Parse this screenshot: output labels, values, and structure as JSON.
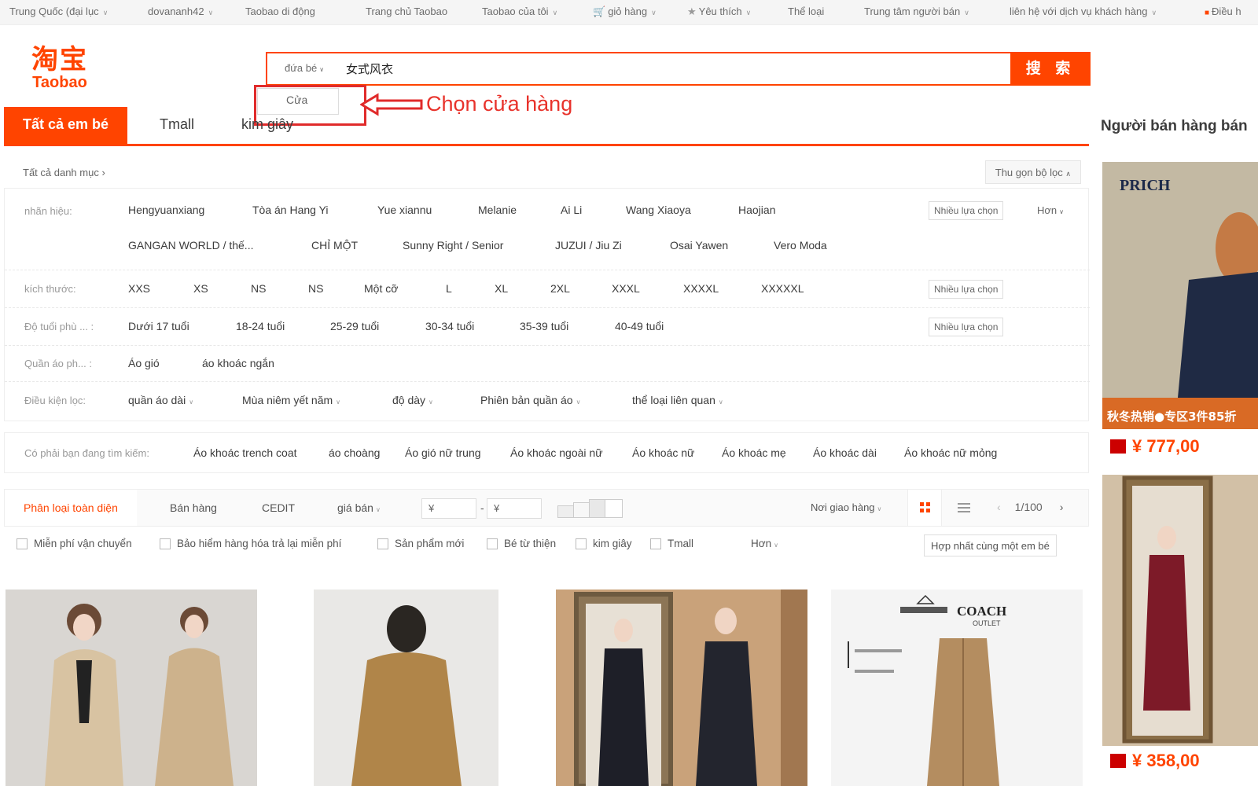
{
  "topbar": {
    "items": [
      "Trung Quốc (đại lục",
      "dovananh42",
      "Taobao di động",
      "Trang chủ Taobao",
      "Taobao của tôi",
      "giỏ hàng",
      "Yêu thích",
      "Thể loại",
      "Trung tâm người bán",
      "liên hệ với dịch vụ khách hàng",
      "Điều h"
    ]
  },
  "logo": {
    "cn": "淘宝",
    "en": "Taobao"
  },
  "search": {
    "scope_label": "đứa bé",
    "query": "女式风衣",
    "button": "搜 索"
  },
  "dropdown": {
    "option": "Cửa"
  },
  "annotation": {
    "text": "Chọn cửa hàng",
    "color": "#e8322b"
  },
  "tabs": [
    "Tất cả em bé",
    "Tmall",
    "kim giây"
  ],
  "seller_panel": {
    "title": "Người bán hàng bán",
    "prices": [
      "¥ 777,00",
      "¥ 358,00"
    ],
    "brand": "PRICH",
    "promo": "秋冬热销●专区3件85折"
  },
  "crumb": {
    "label": "Tất cả danh mục",
    "collapse": "Thu gọn bộ lọc"
  },
  "filters": {
    "brand_label": "nhãn hiệu:",
    "brands_row1": [
      "Hengyuanxiang",
      "Tòa án Hang Yi",
      "Yue xiannu",
      "Melanie",
      "Ai Li",
      "Wang Xiaoya",
      "Haojian"
    ],
    "brands_row2": [
      "GANGAN WORLD / thế...",
      "CHỈ MỘT",
      "Sunny Right / Senior",
      "JUZUI / Jiu Zi",
      "Osai Yawen",
      "Vero Moda"
    ],
    "size_label": "kích thước:",
    "sizes": [
      "XXS",
      "XS",
      "NS",
      "NS",
      "Một cỡ",
      "L",
      "XL",
      "2XL",
      "XXXL",
      "XXXXL",
      "XXXXXL"
    ],
    "age_label": "Độ tuổi phù ... :",
    "ages": [
      "Dưới 17 tuổi",
      "18-24 tuổi",
      "25-29 tuổi",
      "30-34 tuổi",
      "35-39 tuổi",
      "40-49 tuổi"
    ],
    "clothes_label": "Quần áo ph... :",
    "clothes": [
      "Áo gió",
      "áo khoác ngắn"
    ],
    "cond_label": "Điều kiện lọc:",
    "conditions": [
      "quần áo dài",
      "Mùa niêm yết năm",
      "độ dày",
      "Phiên bản quần áo",
      "thể loại liên quan"
    ],
    "multi": "Nhiều lựa chọn",
    "more": "Hơn"
  },
  "suggest": {
    "label": "Có phải bạn đang tìm kiếm:",
    "items": [
      "Áo khoác trench coat",
      "áo choàng",
      "Áo gió nữ trung",
      "Áo khoác ngoài nữ",
      "Áo khoác nữ",
      "Áo khoác mẹ",
      "Áo khoác dài",
      "Áo khoác nữ mỏng"
    ]
  },
  "sortbar": {
    "items": [
      "Phân loại toàn diện",
      "Bán hàng",
      "CEDIT",
      "giá bán"
    ],
    "price_from": "¥",
    "price_to": "¥",
    "ship_from": "Nơi giao hàng",
    "page": "1/100"
  },
  "checks": {
    "items": [
      "Miễn phí vận chuyển",
      "Bảo hiểm hàng hóa trả lại miễn phí",
      "Sản phẩm mới",
      "Bé từ thiện",
      "kim giây",
      "Tmall"
    ],
    "more": "Hơn",
    "merge": "Hợp nhất cùng một em bé"
  },
  "products": [
    {
      "image": "two-women-beige-trench-coat"
    },
    {
      "image": "woman-back-camel-coat"
    },
    {
      "image": "mirror-dark-patterned-coat"
    },
    {
      "image": "coach-outlet-khaki-trench",
      "brand": "COACH",
      "sub": "OUTLET"
    }
  ],
  "colors": {
    "accent": "#ff4400",
    "annotation": "#e8322b"
  }
}
